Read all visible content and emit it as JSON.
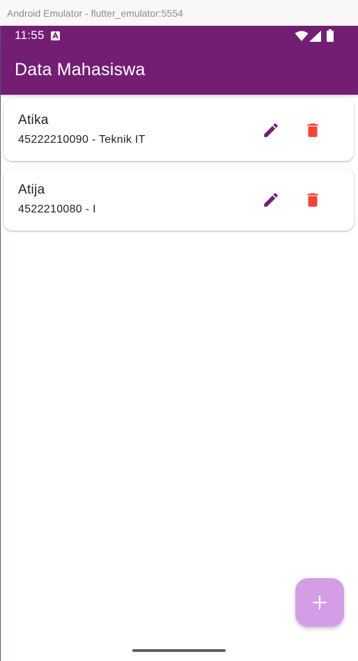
{
  "window": {
    "title": "Android Emulator - flutter_emulator:5554"
  },
  "status_bar": {
    "time": "11:55",
    "icons": [
      "android-a-icon",
      "wifi-icon",
      "cell-signal-icon",
      "battery-icon"
    ]
  },
  "app_bar": {
    "title": "Data Mahasiswa",
    "color": "#741e73"
  },
  "students": [
    {
      "name": "Atika",
      "subtitle": "45222210090 - Teknik IT",
      "edit_icon": "pencil-icon",
      "delete_icon": "trash-icon"
    },
    {
      "name": "Atija",
      "subtitle": "4522210080 - I",
      "edit_icon": "pencil-icon",
      "delete_icon": "trash-icon"
    }
  ],
  "fab": {
    "icon": "plus-icon",
    "color": "#d49de6"
  },
  "colors": {
    "edit_icon": "#741e73",
    "delete_icon": "#f44336"
  }
}
